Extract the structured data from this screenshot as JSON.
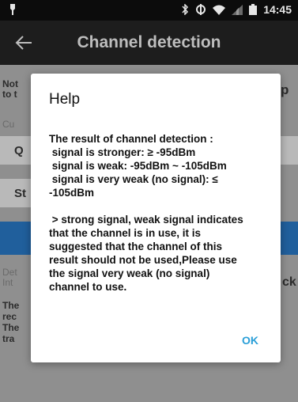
{
  "status_bar": {
    "time": "14:45",
    "icons": [
      "notification-icon",
      "bluetooth-icon",
      "data-sync-icon",
      "wifi-icon",
      "signal-icon",
      "battery-icon"
    ]
  },
  "app_bar": {
    "title": "Channel detection",
    "back_icon": "arrow-left-icon"
  },
  "background": {
    "note_prefix_1": "Not",
    "note_prefix_2": "to t",
    "fragment_p": "p",
    "cur_label": "Cu",
    "q_label": "Q",
    "st_label": "St",
    "detect_prefix": "Det",
    "int_prefix": "Int",
    "ck_fragment": "ck",
    "the_1": "The",
    "rec": "rec",
    "the_2": "The",
    "tra": "tra"
  },
  "dialog": {
    "title": "Help",
    "body_lines": [
      "The result of channel detection :",
      " signal is stronger: ≥ -95dBm",
      " signal is weak: -95dBm ~ -105dBm",
      " signal is very weak (no signal): ≤",
      "-105dBm"
    ],
    "body_lines_2": [
      " > strong signal, weak signal indicates",
      "that the channel is in use, it is",
      "suggested that the channel of this",
      "result should not be used,Please use",
      "the signal very weak (no signal)",
      "channel to use."
    ],
    "ok_label": "OK"
  },
  "colors": {
    "status_bar": "#0c0c0c",
    "app_bar": "#1d1d1d",
    "scrim": "#8f8f8f",
    "accent": "#2a9fd8",
    "button": "#205f9c"
  }
}
